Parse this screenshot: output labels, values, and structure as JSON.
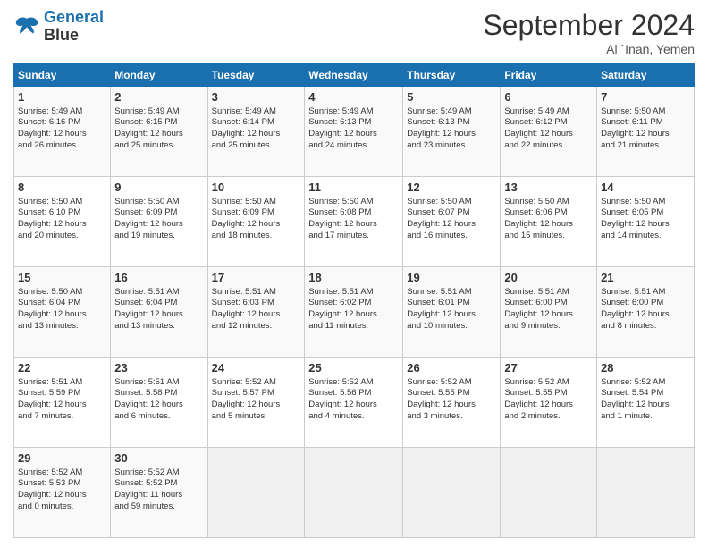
{
  "logo": {
    "line1": "General",
    "line2": "Blue"
  },
  "title": "September 2024",
  "location": "Al `Inan, Yemen",
  "days_header": [
    "Sunday",
    "Monday",
    "Tuesday",
    "Wednesday",
    "Thursday",
    "Friday",
    "Saturday"
  ],
  "weeks": [
    [
      {
        "day": "1",
        "text": "Sunrise: 5:49 AM\nSunset: 6:16 PM\nDaylight: 12 hours\nand 26 minutes."
      },
      {
        "day": "2",
        "text": "Sunrise: 5:49 AM\nSunset: 6:15 PM\nDaylight: 12 hours\nand 25 minutes."
      },
      {
        "day": "3",
        "text": "Sunrise: 5:49 AM\nSunset: 6:14 PM\nDaylight: 12 hours\nand 25 minutes."
      },
      {
        "day": "4",
        "text": "Sunrise: 5:49 AM\nSunset: 6:13 PM\nDaylight: 12 hours\nand 24 minutes."
      },
      {
        "day": "5",
        "text": "Sunrise: 5:49 AM\nSunset: 6:13 PM\nDaylight: 12 hours\nand 23 minutes."
      },
      {
        "day": "6",
        "text": "Sunrise: 5:49 AM\nSunset: 6:12 PM\nDaylight: 12 hours\nand 22 minutes."
      },
      {
        "day": "7",
        "text": "Sunrise: 5:50 AM\nSunset: 6:11 PM\nDaylight: 12 hours\nand 21 minutes."
      }
    ],
    [
      {
        "day": "8",
        "text": "Sunrise: 5:50 AM\nSunset: 6:10 PM\nDaylight: 12 hours\nand 20 minutes."
      },
      {
        "day": "9",
        "text": "Sunrise: 5:50 AM\nSunset: 6:09 PM\nDaylight: 12 hours\nand 19 minutes."
      },
      {
        "day": "10",
        "text": "Sunrise: 5:50 AM\nSunset: 6:09 PM\nDaylight: 12 hours\nand 18 minutes."
      },
      {
        "day": "11",
        "text": "Sunrise: 5:50 AM\nSunset: 6:08 PM\nDaylight: 12 hours\nand 17 minutes."
      },
      {
        "day": "12",
        "text": "Sunrise: 5:50 AM\nSunset: 6:07 PM\nDaylight: 12 hours\nand 16 minutes."
      },
      {
        "day": "13",
        "text": "Sunrise: 5:50 AM\nSunset: 6:06 PM\nDaylight: 12 hours\nand 15 minutes."
      },
      {
        "day": "14",
        "text": "Sunrise: 5:50 AM\nSunset: 6:05 PM\nDaylight: 12 hours\nand 14 minutes."
      }
    ],
    [
      {
        "day": "15",
        "text": "Sunrise: 5:50 AM\nSunset: 6:04 PM\nDaylight: 12 hours\nand 13 minutes."
      },
      {
        "day": "16",
        "text": "Sunrise: 5:51 AM\nSunset: 6:04 PM\nDaylight: 12 hours\nand 13 minutes."
      },
      {
        "day": "17",
        "text": "Sunrise: 5:51 AM\nSunset: 6:03 PM\nDaylight: 12 hours\nand 12 minutes."
      },
      {
        "day": "18",
        "text": "Sunrise: 5:51 AM\nSunset: 6:02 PM\nDaylight: 12 hours\nand 11 minutes."
      },
      {
        "day": "19",
        "text": "Sunrise: 5:51 AM\nSunset: 6:01 PM\nDaylight: 12 hours\nand 10 minutes."
      },
      {
        "day": "20",
        "text": "Sunrise: 5:51 AM\nSunset: 6:00 PM\nDaylight: 12 hours\nand 9 minutes."
      },
      {
        "day": "21",
        "text": "Sunrise: 5:51 AM\nSunset: 6:00 PM\nDaylight: 12 hours\nand 8 minutes."
      }
    ],
    [
      {
        "day": "22",
        "text": "Sunrise: 5:51 AM\nSunset: 5:59 PM\nDaylight: 12 hours\nand 7 minutes."
      },
      {
        "day": "23",
        "text": "Sunrise: 5:51 AM\nSunset: 5:58 PM\nDaylight: 12 hours\nand 6 minutes."
      },
      {
        "day": "24",
        "text": "Sunrise: 5:52 AM\nSunset: 5:57 PM\nDaylight: 12 hours\nand 5 minutes."
      },
      {
        "day": "25",
        "text": "Sunrise: 5:52 AM\nSunset: 5:56 PM\nDaylight: 12 hours\nand 4 minutes."
      },
      {
        "day": "26",
        "text": "Sunrise: 5:52 AM\nSunset: 5:55 PM\nDaylight: 12 hours\nand 3 minutes."
      },
      {
        "day": "27",
        "text": "Sunrise: 5:52 AM\nSunset: 5:55 PM\nDaylight: 12 hours\nand 2 minutes."
      },
      {
        "day": "28",
        "text": "Sunrise: 5:52 AM\nSunset: 5:54 PM\nDaylight: 12 hours\nand 1 minute."
      }
    ],
    [
      {
        "day": "29",
        "text": "Sunrise: 5:52 AM\nSunset: 5:53 PM\nDaylight: 12 hours\nand 0 minutes."
      },
      {
        "day": "30",
        "text": "Sunrise: 5:52 AM\nSunset: 5:52 PM\nDaylight: 11 hours\nand 59 minutes."
      },
      null,
      null,
      null,
      null,
      null
    ]
  ]
}
